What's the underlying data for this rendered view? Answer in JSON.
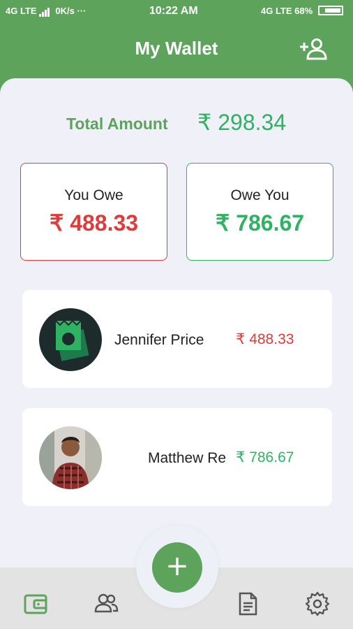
{
  "status_bar": {
    "left": "4G LTE",
    "speed": "0K/s ···",
    "time": "10:22 AM",
    "right_net": "4G LTE",
    "battery": "68%"
  },
  "header": {
    "title": "My Wallet",
    "action_icon": "add-person-icon"
  },
  "total": {
    "label": "Total Amount",
    "value": "₹ 298.34"
  },
  "summary": {
    "you_owe_label": "You Owe",
    "you_owe_value": "₹ 488.33",
    "owe_you_label": "Owe You",
    "owe_you_value": "₹ 786.67"
  },
  "people": [
    {
      "name": "Jennifer Price",
      "amount": "₹ 488.33",
      "avatar": "receipt-icon"
    },
    {
      "name": "Matthew Re",
      "amount": "₹ 786.67",
      "avatar": "photo"
    }
  ],
  "fab": {
    "label": "+"
  },
  "nav": [
    "wallet-icon",
    "people-icon",
    "document-icon",
    "gear-icon"
  ],
  "colors": {
    "brand_green": "#5ea35c",
    "owe_red": "#e03b3b",
    "owed_green": "#2fb262",
    "background": "#f0f1f8"
  }
}
